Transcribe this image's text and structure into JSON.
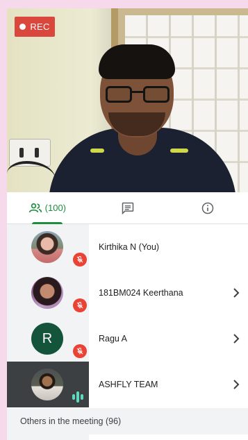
{
  "recording": {
    "label": "REC"
  },
  "tabs": [
    {
      "id": "people",
      "icon": "people-icon",
      "count_label": "(100)",
      "active": true
    },
    {
      "id": "chat",
      "icon": "chat-icon",
      "active": false
    },
    {
      "id": "info",
      "icon": "info-icon",
      "active": false
    }
  ],
  "participants": [
    {
      "name": "Kirthika N (You)",
      "avatar": "photo",
      "muted": true,
      "has_chevron": false
    },
    {
      "name": "181BM024 Keerthana",
      "avatar": "photo",
      "muted": true,
      "has_chevron": true
    },
    {
      "name": "Ragu A",
      "avatar": "initial",
      "initial": "R",
      "avatar_color": "#13543a",
      "muted": true,
      "has_chevron": true
    },
    {
      "name": "ASHFLY TEAM",
      "avatar": "photo",
      "muted": false,
      "speaking": true,
      "has_chevron": true
    }
  ],
  "others": {
    "label": "Others in the meeting (96)"
  },
  "colors": {
    "accent": "#1e8e3e",
    "mute_red": "#ea4335",
    "rec_red": "#d9473d",
    "speaking": "#5fd8c0"
  }
}
